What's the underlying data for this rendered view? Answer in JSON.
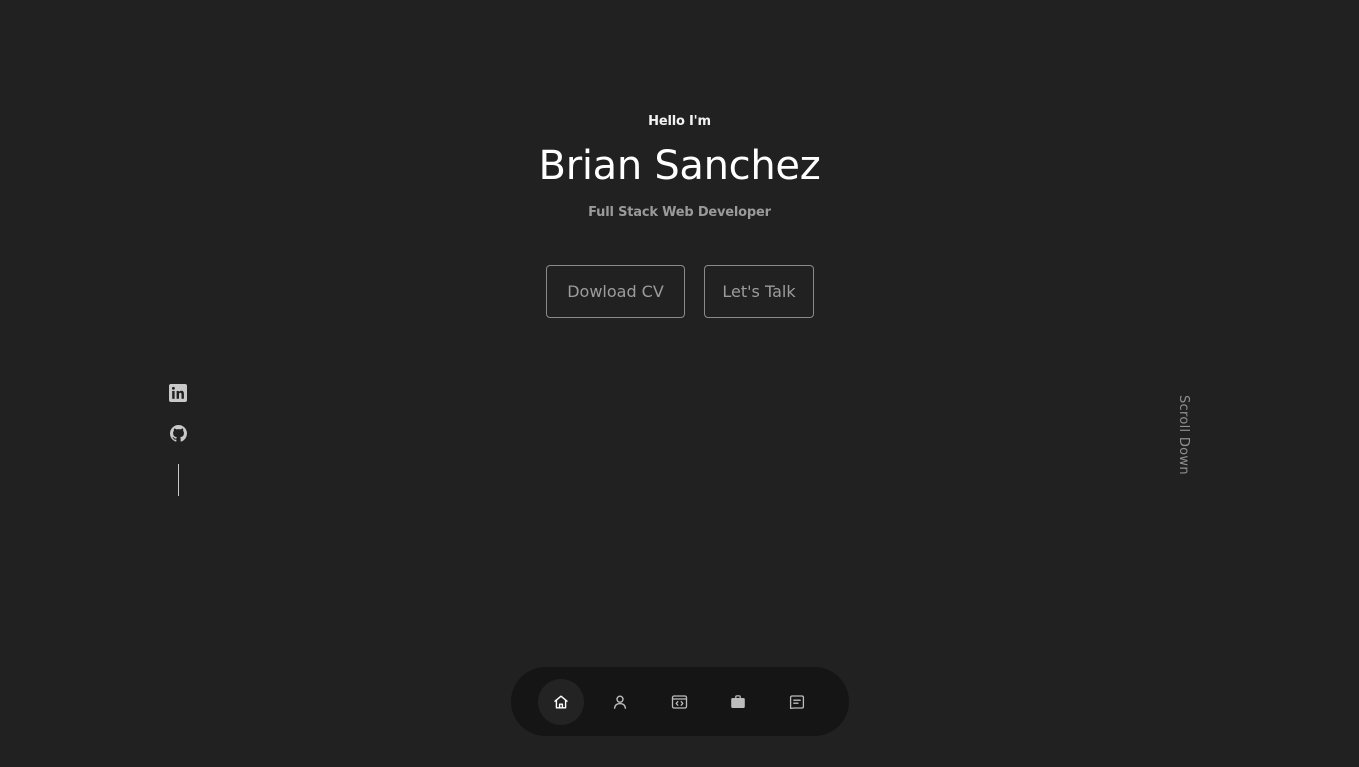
{
  "hero": {
    "greeting": "Hello I'm",
    "name": "Brian Sanchez",
    "role": "Full Stack Web Developer"
  },
  "buttons": {
    "download_cv": "Dowload CV",
    "lets_talk": "Let's Talk"
  },
  "socials": {
    "items": [
      {
        "icon": "linkedin-icon"
      },
      {
        "icon": "github-icon"
      }
    ]
  },
  "scroll": {
    "label": "Scroll Down"
  },
  "nav": {
    "items": [
      {
        "icon": "home-icon",
        "active": true
      },
      {
        "icon": "user-icon",
        "active": false
      },
      {
        "icon": "code-window-icon",
        "active": false
      },
      {
        "icon": "briefcase-icon",
        "active": false
      },
      {
        "icon": "message-icon",
        "active": false
      }
    ]
  },
  "colors": {
    "background": "#212121",
    "nav_background": "#151515",
    "accent_text": "#ffffff",
    "muted_text": "#9a9a9a"
  }
}
